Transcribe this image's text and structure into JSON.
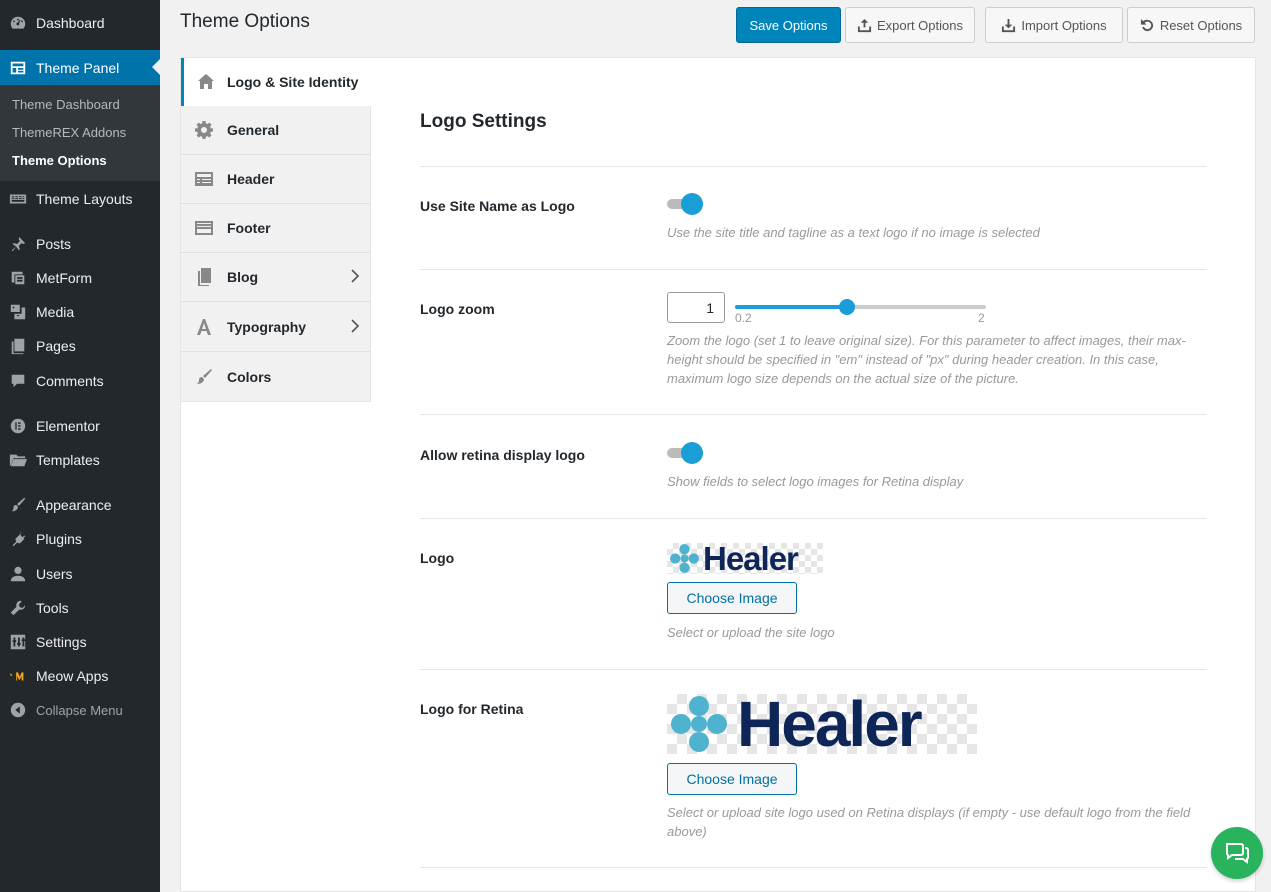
{
  "sidebar": {
    "items": [
      {
        "label": "Dashboard",
        "icon": "dashboard-icon"
      },
      {
        "label": "Theme Panel",
        "icon": "theme-panel-icon"
      },
      {
        "label": "Theme Layouts",
        "icon": "layouts-icon"
      },
      {
        "label": "Posts",
        "icon": "pin-icon"
      },
      {
        "label": "MetForm",
        "icon": "form-icon"
      },
      {
        "label": "Media",
        "icon": "media-icon"
      },
      {
        "label": "Pages",
        "icon": "pages-icon"
      },
      {
        "label": "Comments",
        "icon": "comment-icon"
      },
      {
        "label": "Elementor",
        "icon": "elementor-icon"
      },
      {
        "label": "Templates",
        "icon": "folder-icon"
      },
      {
        "label": "Appearance",
        "icon": "brush-icon"
      },
      {
        "label": "Plugins",
        "icon": "plug-icon"
      },
      {
        "label": "Users",
        "icon": "user-icon"
      },
      {
        "label": "Tools",
        "icon": "wrench-icon"
      },
      {
        "label": "Settings",
        "icon": "sliders-icon"
      },
      {
        "label": "Meow Apps",
        "icon": "meow-icon"
      }
    ],
    "submenu": [
      "Theme Dashboard",
      "ThemeREX Addons",
      "Theme Options"
    ],
    "collapse_label": "Collapse Menu"
  },
  "header": {
    "title": "Theme Options"
  },
  "toolbar": {
    "save_label": "Save Options",
    "export_label": "Export Options",
    "import_label": "Import Options",
    "reset_label": "Reset Options"
  },
  "tabs": [
    "Logo & Site Identity",
    "General",
    "Header",
    "Footer",
    "Blog",
    "Typography",
    "Colors"
  ],
  "content": {
    "section_title": "Logo Settings",
    "site_name_logo": {
      "label": "Use Site Name as Logo",
      "enabled": true,
      "desc": "Use the site title and tagline as a text logo if no image is selected"
    },
    "logo_zoom": {
      "label": "Logo zoom",
      "value": "1",
      "min": 0.2,
      "max": 2,
      "min_label": "0.2",
      "max_label": "2",
      "desc": "Zoom the logo (set 1 to leave original size). For this parameter to affect images, their max-height should be specified in \"em\" instead of \"px\" during header creation. In this case, maximum logo size depends on the actual size of the picture."
    },
    "retina_logo": {
      "label": "Allow retina display logo",
      "enabled": true,
      "desc": "Show fields to select logo images for Retina display"
    },
    "logo": {
      "label": "Logo",
      "logo_text": "Healer",
      "button_label": "Choose Image",
      "desc": "Select or upload the site logo"
    },
    "logo_retina": {
      "label": "Logo for Retina",
      "logo_text": "Healer",
      "button_label": "Choose Image",
      "desc": "Select or upload site logo used on Retina displays (if empty - use default logo from the field above)"
    }
  },
  "colors": {
    "accent": "#0085ba",
    "toggle": "#1a9ed8",
    "sidebar": "#23282d",
    "logo_blue": "#0d2557",
    "logo_teal": "#4fb3d0",
    "chat": "#29b35c"
  }
}
